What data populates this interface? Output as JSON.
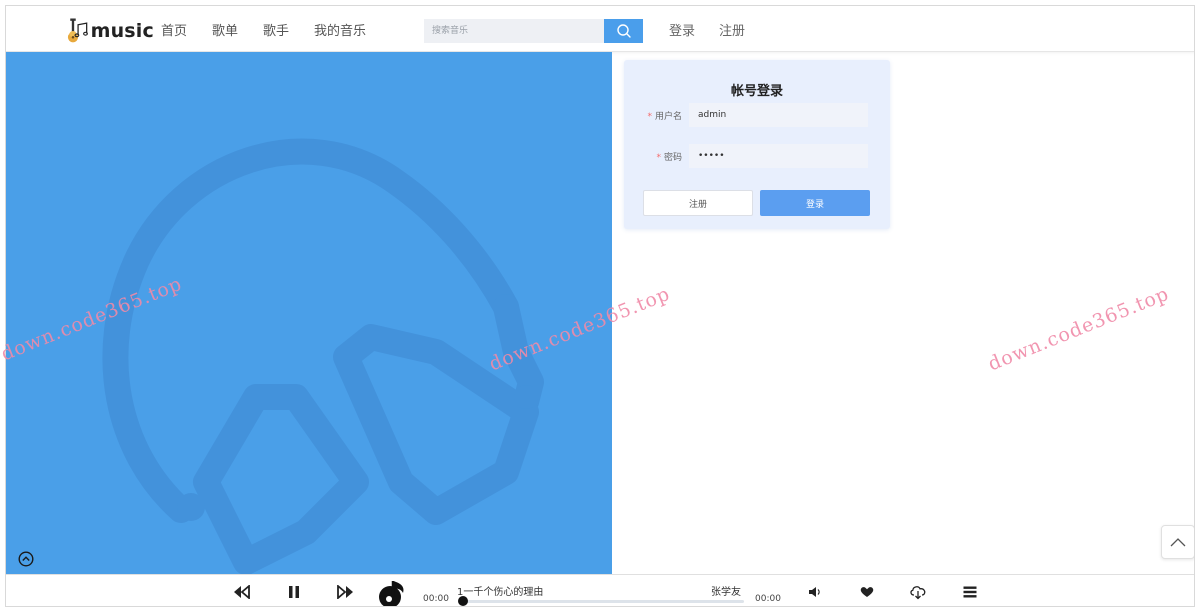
{
  "header": {
    "logo_text": "music",
    "nav": [
      "首页",
      "歌单",
      "歌手",
      "我的音乐"
    ],
    "search_placeholder": "搜索音乐",
    "login_link": "登录",
    "register_link": "注册"
  },
  "login": {
    "title": "帐号登录",
    "username_label": "用户名",
    "username_value": "admin",
    "password_label": "密码",
    "password_value": "•••••",
    "register_button": "注册",
    "login_button": "登录"
  },
  "watermark": "down.code365.top",
  "player": {
    "current_time": "00:00",
    "total_time": "00:00",
    "song_title": "1一千个伤心的理由",
    "artist": "张学友",
    "progress": 0
  },
  "colors": {
    "accent": "#4a9eeb",
    "banner": "#4a9fe8",
    "watermark": "#f08aa8"
  }
}
